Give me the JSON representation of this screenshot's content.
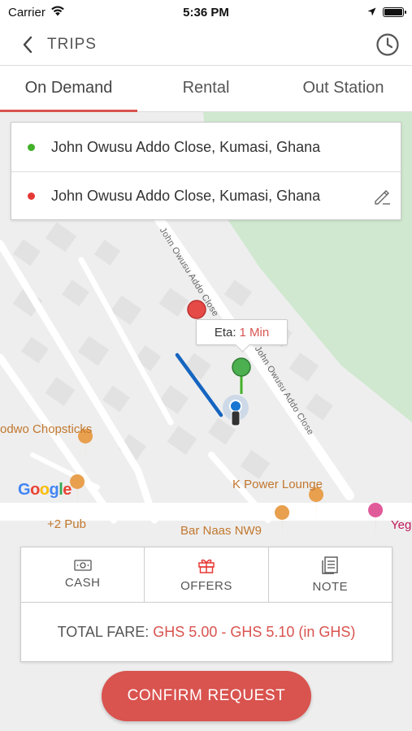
{
  "status_bar": {
    "carrier": "Carrier",
    "time": "5:36 PM",
    "battery_level": 1.0
  },
  "header": {
    "title": "TRIPS",
    "back_icon": "chevron-left-icon",
    "history_icon": "clock-icon"
  },
  "tabs": [
    {
      "label": "On Demand",
      "active": true
    },
    {
      "label": "Rental",
      "active": false
    },
    {
      "label": "Out Station",
      "active": false
    }
  ],
  "pickup": {
    "address": "John Owusu Addo Close, Kumasi, Ghana",
    "color": "#43b02a"
  },
  "dropoff": {
    "address": "John Owusu Addo Close, Kumasi, Ghana",
    "color": "#e53935"
  },
  "map": {
    "eta_label": "Eta:",
    "eta_value": "1 Min",
    "street_name": "John Owusu Addo Close",
    "places": [
      {
        "name": "odwo Chopsticks",
        "color": "#c1772e"
      },
      {
        "name": "K Power Lounge",
        "color": "#c1772e"
      },
      {
        "name": "+2 Pub",
        "color": "#c1772e"
      },
      {
        "name": "Bar Naas NW9",
        "color": "#c1772e"
      },
      {
        "name": "Yeg",
        "color": "#c2185b"
      }
    ],
    "google_logo": "Google"
  },
  "payment": {
    "options": [
      {
        "label": "CASH",
        "icon": "cash-icon"
      },
      {
        "label": "OFFERS",
        "icon": "gift-icon"
      },
      {
        "label": "NOTE",
        "icon": "note-icon"
      }
    ],
    "fare_label": "TOTAL FARE:",
    "fare_value": "GHS 5.00 - GHS 5.10 (in GHS)"
  },
  "confirm_label": "CONFIRM REQUEST",
  "colors": {
    "accent": "#d9534f",
    "route": "#1565c0",
    "park": "#cfe8cf"
  }
}
